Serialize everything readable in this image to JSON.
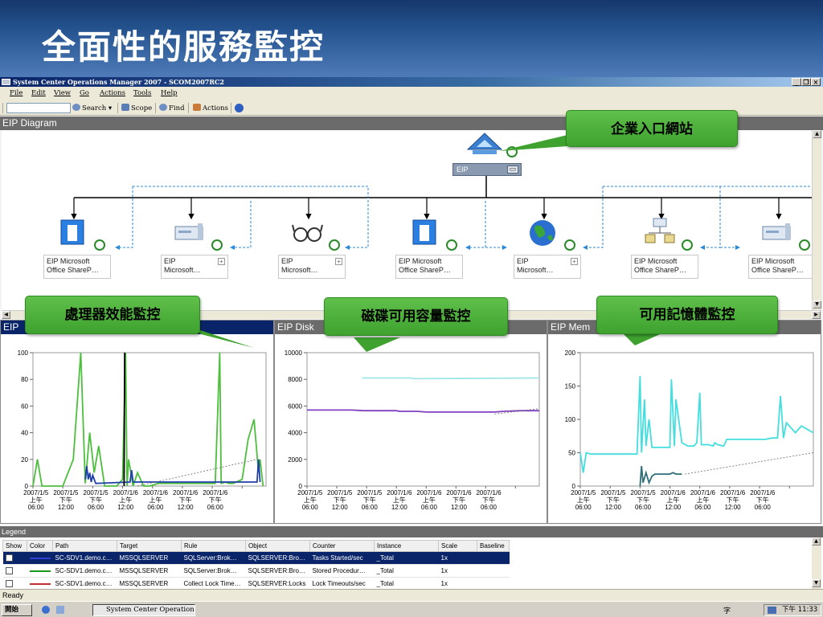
{
  "slide": {
    "title": "全面性的服務監控"
  },
  "app": {
    "title": "System Center Operations Manager 2007 - SCOM2007RC2",
    "win_min": "_",
    "win_restore": "❐",
    "win_close": "×"
  },
  "menu": [
    "File",
    "Edit",
    "View",
    "Go",
    "Actions",
    "Tools",
    "Help"
  ],
  "toolbar": {
    "search": "Search",
    "scope": "Scope",
    "find": "Find",
    "actions": "Actions"
  },
  "diagram": {
    "title": "EIP Diagram",
    "root": {
      "label": "EIP",
      "expand": "▭"
    },
    "nodes": [
      {
        "l1": "EIP Microsoft",
        "l2": "Office ShareP…",
        "icon": "app-window-icon"
      },
      {
        "l1": "EIP",
        "l2": "Microsoft…",
        "icon": "server-icon",
        "expand": "+"
      },
      {
        "l1": "EIP",
        "l2": "Microsoft…",
        "icon": "glasses-icon",
        "expand": "+"
      },
      {
        "l1": "EIP Microsoft",
        "l2": "Office ShareP…",
        "icon": "app-window-icon"
      },
      {
        "l1": "EIP",
        "l2": "Microsoft…",
        "icon": "globe-icon",
        "expand": "+"
      },
      {
        "l1": "EIP Microsoft",
        "l2": "Office ShareP…",
        "icon": "network-icon"
      },
      {
        "l1": "EIP Microsoft",
        "l2": "Office ShareP…",
        "icon": "server-icon"
      }
    ]
  },
  "callouts": {
    "portal": "企業入口網站",
    "cpu": "處理器效能監控",
    "disk": "磁碟可用容量監控",
    "memory": "可用記憶體監控"
  },
  "x_ticks": [
    {
      "l1": "2007/1/5",
      "l2": "上午",
      "l3": "06:00"
    },
    {
      "l1": "2007/1/5",
      "l2": "下午",
      "l3": "12:00"
    },
    {
      "l1": "2007/1/5",
      "l2": "下午",
      "l3": "06:00"
    },
    {
      "l1": "2007/1/6",
      "l2": "上午",
      "l3": "12:00"
    },
    {
      "l1": "2007/1/6",
      "l2": "上午",
      "l3": "06:00"
    },
    {
      "l1": "2007/1/6",
      "l2": "下午",
      "l3": "12:00"
    },
    {
      "l1": "2007/1/6",
      "l2": "下午",
      "l3": "06:00"
    }
  ],
  "chart_data": [
    {
      "type": "line",
      "title": "EIP",
      "ylim": [
        0,
        100
      ],
      "yticks": [
        0,
        20,
        40,
        60,
        80,
        100
      ],
      "xlim": [
        0,
        7.8
      ],
      "series": [
        {
          "color": "#4cbf3c",
          "x": [
            0,
            0.15,
            0.3,
            0.5,
            1.0,
            1.35,
            1.6,
            1.75,
            1.9,
            2.05,
            2.2,
            2.4,
            2.6,
            2.8,
            3.0,
            3.1,
            3.15,
            3.2,
            3.35,
            3.5,
            3.7,
            3.9,
            4.2,
            6.0,
            6.1,
            6.25,
            6.3,
            6.45,
            6.55,
            6.7,
            7.0,
            7.2,
            7.4,
            7.55,
            7.6,
            7.7
          ],
          "y": [
            0,
            20,
            0,
            0,
            0,
            20,
            100,
            2,
            40,
            10,
            30,
            0,
            0,
            0,
            5,
            100,
            0,
            20,
            0,
            10,
            0,
            0,
            2,
            2,
            2,
            100,
            2,
            3,
            2,
            2,
            5,
            35,
            50,
            10,
            20,
            0
          ]
        },
        {
          "color": "#1f3fa8",
          "x": [
            1.75,
            1.8,
            1.85,
            1.9,
            1.95,
            2.0,
            2.1,
            3.25,
            3.3,
            3.35,
            7.5,
            7.55,
            7.6
          ],
          "y": [
            5,
            15,
            5,
            10,
            3,
            8,
            2,
            3,
            12,
            3,
            3,
            20,
            3
          ]
        },
        {
          "color": "#000000",
          "x": [
            3.05,
            3.07
          ],
          "y": [
            0,
            100
          ]
        },
        {
          "color": "#6b6b6b",
          "dash": "2,2",
          "x": [
            3.5,
            7.5
          ],
          "y": [
            0,
            20
          ]
        }
      ]
    },
    {
      "type": "line",
      "title": "EIP Disk",
      "ylim": [
        0,
        10000
      ],
      "yticks": [
        0,
        2000,
        4000,
        6000,
        8000,
        10000
      ],
      "xlim": [
        0,
        7.8
      ],
      "series": [
        {
          "color": "#7e3fc0",
          "x": [
            0,
            1.5,
            1.9,
            3.0,
            3.1,
            3.7,
            4.0,
            6.3,
            6.6,
            7.2,
            7.8
          ],
          "y": [
            5700,
            5700,
            5650,
            5650,
            5600,
            5600,
            5550,
            5550,
            5600,
            5650,
            5650
          ]
        },
        {
          "color": "#9fe6e6",
          "x": [
            1.85,
            3.5,
            3.6,
            7.8
          ],
          "y": [
            8100,
            8100,
            8050,
            8100
          ]
        },
        {
          "color": "#6b6b6b",
          "dash": "2,2",
          "x": [
            6.3,
            7.8
          ],
          "y": [
            5400,
            5800
          ]
        }
      ]
    },
    {
      "type": "line",
      "title": "EIP Mem",
      "ylim": [
        0,
        200
      ],
      "yticks": [
        0,
        50,
        100,
        150,
        200
      ],
      "xlim": [
        0,
        7.8
      ],
      "series": [
        {
          "color": "#44dede",
          "x": [
            0,
            0.1,
            0.2,
            0.35,
            1.0,
            1.9,
            2.0,
            2.05,
            2.15,
            2.2,
            2.3,
            2.4,
            2.7,
            3.0,
            3.05,
            3.15,
            3.2,
            3.4,
            3.6,
            3.8,
            3.9,
            4.0,
            4.05,
            4.3,
            4.45,
            4.5,
            4.6,
            4.8,
            4.9,
            5.0,
            5.1,
            6.0,
            6.2,
            6.4,
            6.6,
            6.7,
            6.8,
            6.9,
            7.2,
            7.4,
            7.6,
            7.8
          ],
          "y": [
            50,
            20,
            50,
            48,
            48,
            48,
            165,
            50,
            130,
            60,
            100,
            58,
            58,
            58,
            160,
            60,
            130,
            65,
            60,
            60,
            65,
            140,
            62,
            62,
            60,
            65,
            62,
            60,
            70,
            70,
            70,
            70,
            70,
            72,
            72,
            135,
            72,
            95,
            80,
            90,
            85,
            80
          ]
        },
        {
          "color": "#2e6f7a",
          "x": [
            2.0,
            2.05,
            2.1,
            2.2,
            2.3,
            2.4,
            2.5,
            3.0,
            3.1,
            3.2,
            3.3,
            3.4
          ],
          "y": [
            0,
            30,
            5,
            20,
            5,
            15,
            18,
            18,
            20,
            18,
            18,
            18
          ]
        },
        {
          "color": "#6b6b6b",
          "dash": "2,2",
          "x": [
            3.5,
            7.8
          ],
          "y": [
            18,
            50
          ]
        }
      ]
    }
  ],
  "legend": {
    "title": "Legend",
    "columns": [
      "Show",
      "Color",
      "Path",
      "Target",
      "Rule",
      "Object",
      "Counter",
      "Instance",
      "Scale",
      "Baseline"
    ],
    "rows": [
      {
        "color": "#2f3fd8",
        "path": "SC-SDV1.demo.c…",
        "target": "MSSQLSERVER",
        "rule": "SQLServer:Brok…",
        "object": "SQLSERVER:Bro…",
        "counter": "Tasks Started/sec",
        "instance": "_Total",
        "scale": "1x"
      },
      {
        "color": "#1a9a1a",
        "path": "SC-SDV1.demo.c…",
        "target": "MSSQLSERVER",
        "rule": "SQLServer:Brok…",
        "object": "SQLSERVER:Bro…",
        "counter": "Stored Procedur…",
        "instance": "_Total",
        "scale": "1x"
      },
      {
        "color": "#c03030",
        "path": "SC-SDV1.demo.c…",
        "target": "MSSQLSERVER",
        "rule": "Collect Lock Time…",
        "object": "SQLSERVER:Locks",
        "counter": "Lock Timeouts/sec",
        "instance": "_Total",
        "scale": "1x"
      }
    ]
  },
  "status": {
    "text": "Ready"
  },
  "taskbar": {
    "start": "開始",
    "task": "System Center Operations …",
    "clock": "下午 11:33"
  }
}
